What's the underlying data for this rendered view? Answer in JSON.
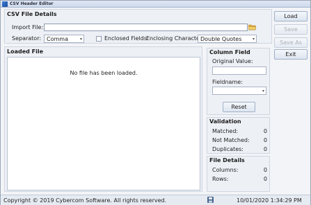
{
  "window": {
    "title": "CSV Header Editor"
  },
  "csv_details": {
    "heading": "CSV File Details",
    "import_label": "Import File:",
    "import_value": "",
    "separator_label": "Separator:",
    "separator_value": "Comma",
    "enclosed_label": "Enclosed Fields",
    "enclosed_checked": false,
    "enclosing_label": "Enclosing Character:",
    "enclosing_value": "Double Quotes"
  },
  "loaded_file": {
    "heading": "Loaded File",
    "empty_message": "No file has been loaded."
  },
  "buttons": {
    "load": "Load",
    "save": "Save",
    "save_as": "Save As",
    "exit": "Exit"
  },
  "column_field": {
    "heading": "Column Field",
    "original_label": "Original Value:",
    "original_value": "",
    "fieldname_label": "Fieldname:",
    "fieldname_value": "",
    "reset": "Reset"
  },
  "validation": {
    "heading": "Validation",
    "matched_label": "Matched:",
    "matched": "0",
    "not_matched_label": "Not Matched:",
    "not_matched": "0",
    "duplicates_label": "Duplicates:",
    "duplicates": "0"
  },
  "file_details": {
    "heading": "File Details",
    "columns_label": "Columns:",
    "columns": "0",
    "rows_label": "Rows:",
    "rows": "0"
  },
  "status": {
    "copyright": "Copyright © 2019 Cybercom Software.  All rights reserved.",
    "datetime": "10/01/2020 1:34:29 PM"
  },
  "icons": {
    "folder": "folder-icon",
    "save": "save-icon"
  }
}
